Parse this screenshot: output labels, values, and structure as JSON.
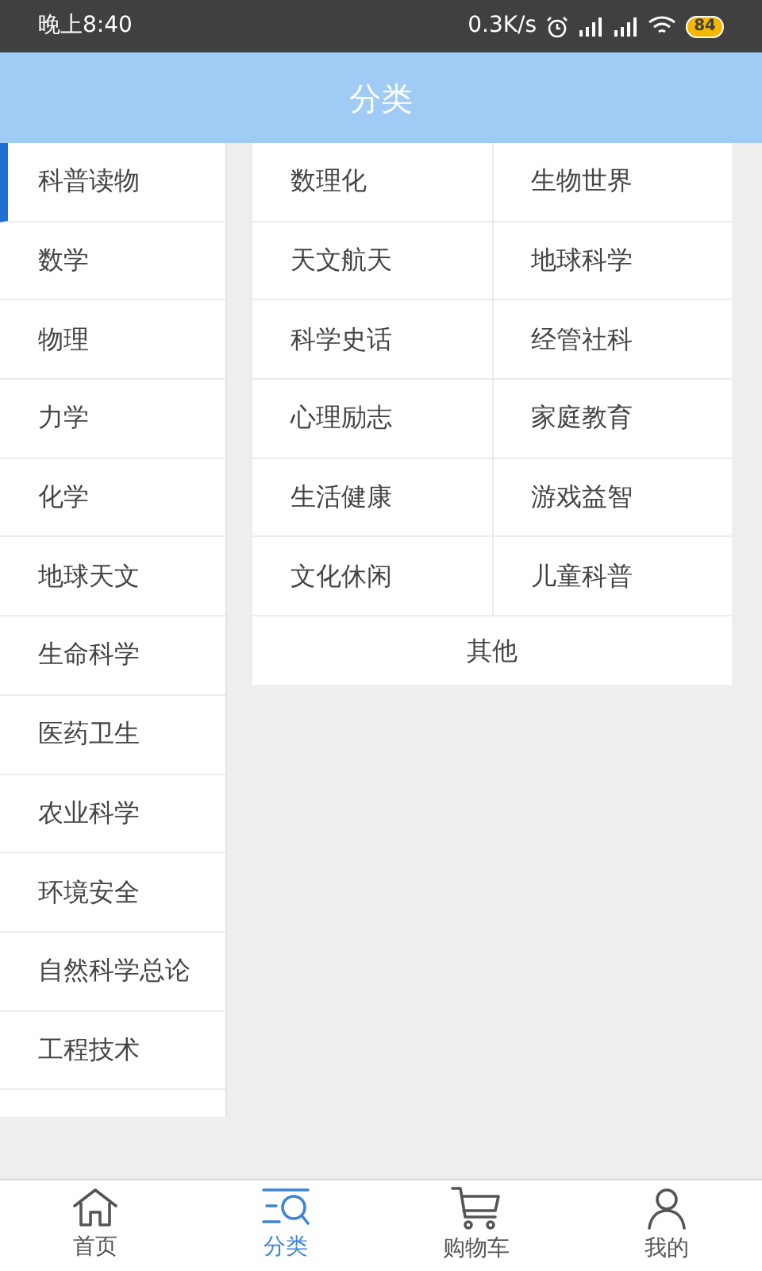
{
  "status_bar": {
    "time": "晚上8:40",
    "speed": "0.3K/s",
    "battery": "84"
  },
  "header": {
    "title": "分类"
  },
  "sidebar": {
    "items": [
      {
        "label": "科普读物",
        "selected": true
      },
      {
        "label": "数学",
        "selected": false
      },
      {
        "label": "物理",
        "selected": false
      },
      {
        "label": "力学",
        "selected": false
      },
      {
        "label": "化学",
        "selected": false
      },
      {
        "label": "地球天文",
        "selected": false
      },
      {
        "label": "生命科学",
        "selected": false
      },
      {
        "label": "医药卫生",
        "selected": false
      },
      {
        "label": "农业科学",
        "selected": false
      },
      {
        "label": "环境安全",
        "selected": false
      },
      {
        "label": "自然科学总论",
        "selected": false
      },
      {
        "label": "工程技术",
        "selected": false
      }
    ]
  },
  "subcategories": [
    "数理化",
    "生物世界",
    "天文航天",
    "地球科学",
    "科学史话",
    "经管社科",
    "心理励志",
    "家庭教育",
    "生活健康",
    "游戏益智",
    "文化休闲",
    "儿童科普"
  ],
  "other": "其他",
  "tab_bar": [
    {
      "label": "首页",
      "kind": "home",
      "selected": false
    },
    {
      "label": "分类",
      "kind": "category",
      "selected": true
    },
    {
      "label": "购物车",
      "kind": "cart",
      "selected": false
    },
    {
      "label": "我的",
      "kind": "user",
      "selected": false
    }
  ]
}
